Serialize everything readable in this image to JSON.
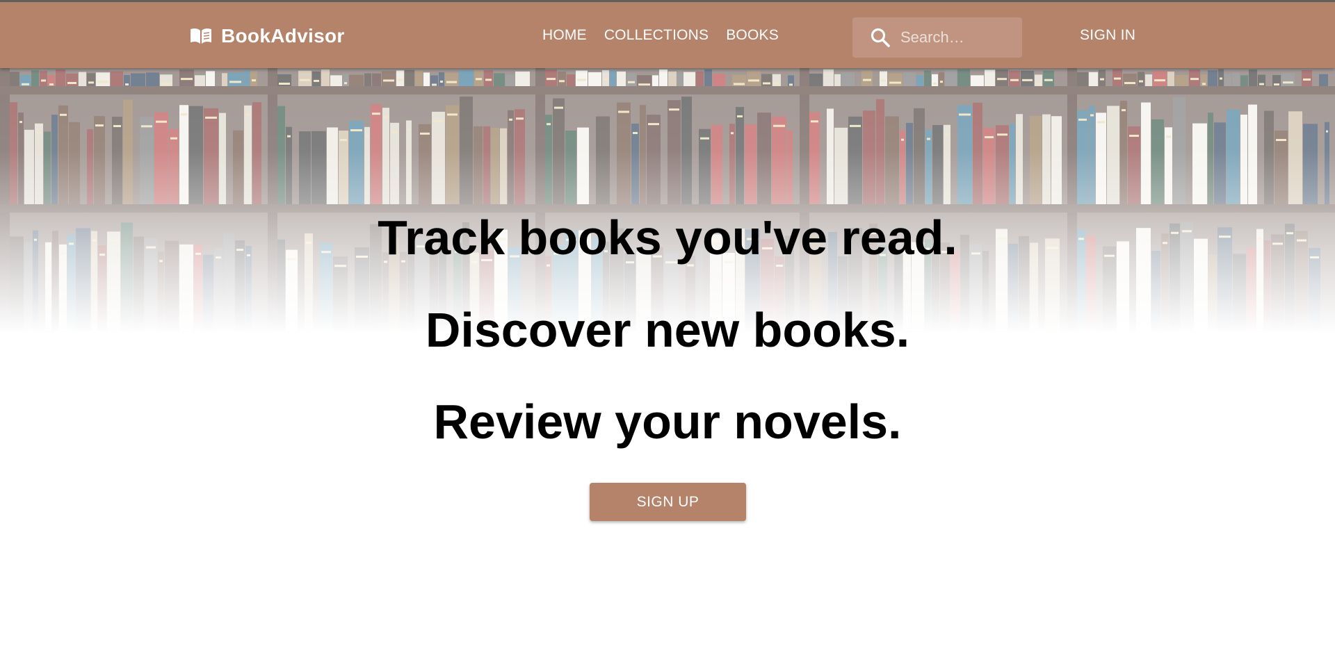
{
  "brand": {
    "name": "BookAdvisor",
    "icon": "open-book-icon"
  },
  "nav": {
    "items": [
      {
        "label": "HOME"
      },
      {
        "label": "COLLECTIONS"
      },
      {
        "label": "BOOKS"
      }
    ]
  },
  "search": {
    "placeholder": "Search…",
    "value": "",
    "icon": "search-icon"
  },
  "account": {
    "signin_label": "SIGN IN"
  },
  "hero": {
    "lines": [
      "Track books you've read.",
      "Discover new books.",
      "Review your novels."
    ],
    "signup_label": "SIGN UP"
  },
  "colors": {
    "accent": "#b5826a",
    "nav_text": "#ffffff",
    "headline": "#000000"
  }
}
